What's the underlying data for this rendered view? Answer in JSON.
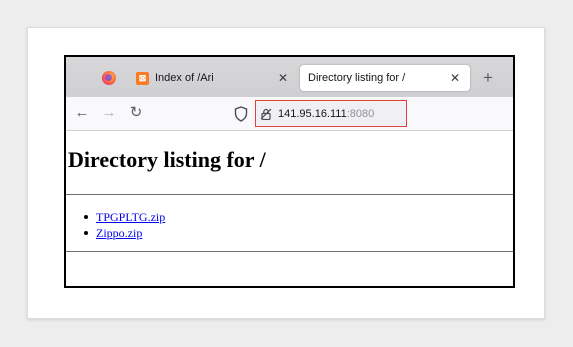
{
  "browser": {
    "tabs": [
      {
        "title": "Index of /Ari",
        "icon": "xampp-icon",
        "active": false,
        "icon_letter": "⊠"
      },
      {
        "title": "Directory listing for /",
        "icon": "",
        "active": true
      }
    ],
    "close_glyph": "✕",
    "new_tab_glyph": "+",
    "nav": {
      "back_glyph": "←",
      "forward_glyph": "→",
      "reload_glyph": "↻"
    },
    "url": {
      "host": "141.95.16.111",
      "port": ":8080"
    },
    "highlight_color": "#e0433a"
  },
  "page": {
    "heading": "Directory listing for /",
    "files": [
      {
        "name": "TPGPLTG.zip"
      },
      {
        "name": "Zippo.zip"
      }
    ]
  }
}
